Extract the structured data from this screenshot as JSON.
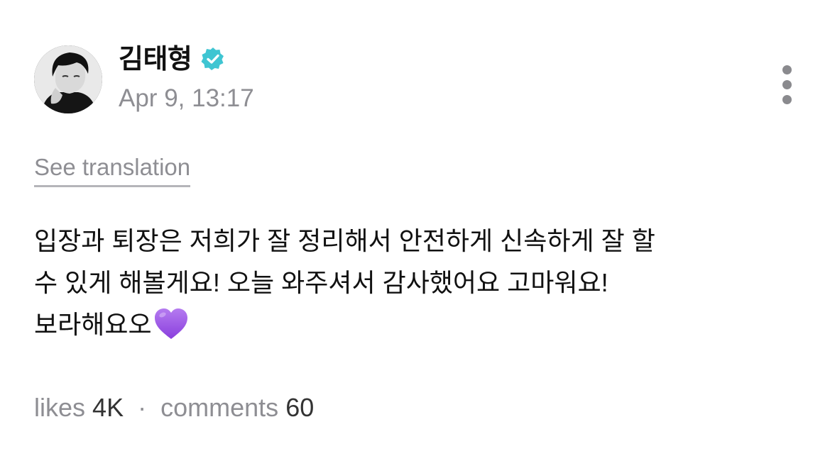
{
  "post": {
    "author": {
      "name": "김태형",
      "verified_icon": "verified-badge-icon",
      "avatar_icon": "avatar-photo"
    },
    "timestamp": "Apr 9, 13:17",
    "more_icon": "more-vertical-icon",
    "see_translation": "See translation",
    "body_lines": [
      "입장과 퇴장은 저희가 잘 정리해서 안전하게 신속하게 잘 할",
      "수 있게 해볼게요! 오늘 와주셔서 감사했어요 고마워요!",
      "보라해요오"
    ],
    "body_emoji": "purple-heart-icon",
    "stats": {
      "likes_label": "likes",
      "likes_count": "4K",
      "separator": "·",
      "comments_label": "comments",
      "comments_count": "60"
    }
  },
  "colors": {
    "verified": "#3FC5D2",
    "secondary_text": "#8E8E93",
    "heart": "#9B59E5"
  }
}
